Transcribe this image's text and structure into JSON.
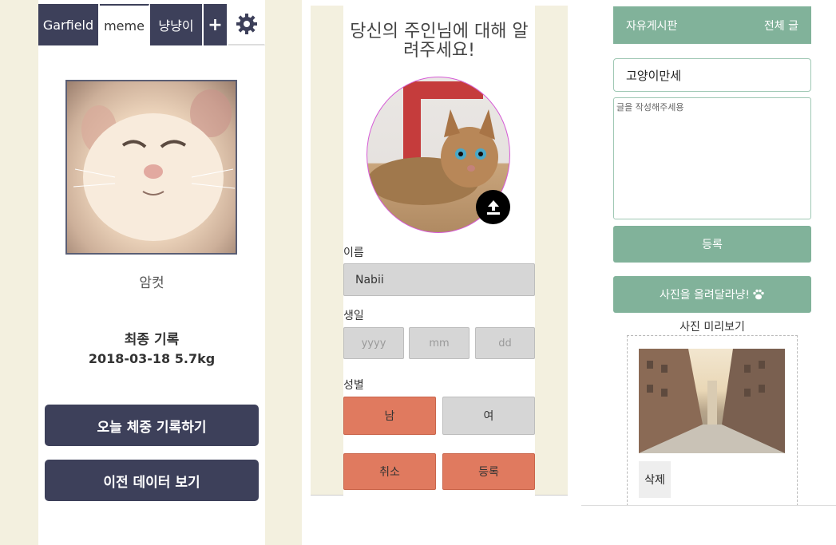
{
  "panel1": {
    "tabs": [
      "Garfield",
      "meme",
      "냥냥이"
    ],
    "add_tab_label": "+",
    "cat_name": "암컷",
    "record_title": "최종 기록",
    "record_value": "2018-03-18 5.7kg",
    "record_button": "오늘 체중 기록하기",
    "history_button": "이전 데이터 보기",
    "colors": {
      "navy": "#3d405a",
      "background": "#f3f0df"
    }
  },
  "panel2": {
    "heading": "당신의 주인님에 대해 알려주세요!",
    "name_label": "이름",
    "name_value": "Nabii",
    "birthday_label": "생일",
    "year_placeholder": "yyyy",
    "month_placeholder": "mm",
    "day_placeholder": "dd",
    "gender_label": "성별",
    "male_label": "남",
    "female_label": "여",
    "cancel_label": "취소",
    "submit_label": "등록",
    "colors": {
      "accent": "#e07a5f",
      "neutral": "#d6d6d6"
    }
  },
  "panel3": {
    "header_title": "자유게시판",
    "header_link": "전체 글",
    "title_value": "고양이만세",
    "content_placeholder": "글을 작성해주세용",
    "register_label": "등록",
    "upload_label": "사진을 올려달라냥!",
    "preview_label": "사진 미리보기",
    "delete_label": "삭제",
    "colors": {
      "green": "#81b29a"
    }
  }
}
